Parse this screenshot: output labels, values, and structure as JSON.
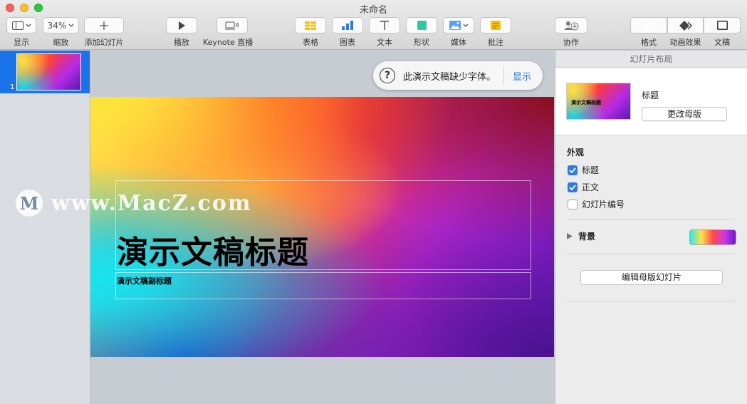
{
  "window": {
    "title": "未命名"
  },
  "toolbar": {
    "view_label": "显示",
    "zoom_value": "34%",
    "zoom_label": "缩放",
    "add_slide_label": "添加幻灯片",
    "play_label": "播放",
    "keynote_live_label": "Keynote 直播",
    "table_label": "表格",
    "chart_label": "图表",
    "text_label": "文本",
    "shape_label": "形状",
    "media_label": "媒体",
    "comment_label": "批注",
    "collaborate_label": "协作",
    "format_label": "格式",
    "animate_label": "动画效果",
    "document_label": "文稿"
  },
  "navigator": {
    "slides": [
      {
        "number": "1"
      }
    ]
  },
  "slide": {
    "title": "演示文稿标题",
    "subtitle": "演示文稿副标题"
  },
  "watermark": {
    "text": "www.MacZ.com"
  },
  "missing_fonts": {
    "message": "此演示文稿缺少字体。",
    "action": "显示"
  },
  "inspector": {
    "header": "幻灯片布局",
    "master_name": "标题",
    "master_thumb_text": "演示文稿标题",
    "change_master_button": "更改母版",
    "appearance_title": "外观",
    "options": [
      {
        "label": "标题",
        "checked": true
      },
      {
        "label": "正文",
        "checked": true
      },
      {
        "label": "幻灯片编号",
        "checked": false
      }
    ],
    "background_label": "背景",
    "edit_master_button": "编辑母版幻灯片"
  },
  "colors": {
    "accent": "#2f7be3",
    "selection": "#1a73e8",
    "link": "#1a6fd8"
  }
}
